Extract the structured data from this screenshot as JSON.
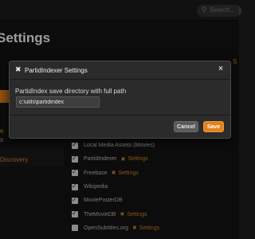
{
  "app": {
    "page_title": "Settings",
    "search_placeholder": "Search..."
  },
  "background_left": {
    "frag1": "e",
    "frag2": "s",
    "discovery": "Discovery"
  },
  "background_right": {
    "frag": "S"
  },
  "plugins": [
    {
      "name": "Local Media Assets (Movies)",
      "checked": true,
      "settings": ""
    },
    {
      "name": "PartidIndexer",
      "checked": true,
      "settings": "Settings"
    },
    {
      "name": "Freebase",
      "checked": true,
      "settings": "Settings"
    },
    {
      "name": "Wikipedia",
      "checked": true,
      "settings": ""
    },
    {
      "name": "MoviePosterDB",
      "checked": true,
      "settings": ""
    },
    {
      "name": "TheMovieDB",
      "checked": true,
      "settings": "Settings"
    },
    {
      "name": "OpenSubtitles.org",
      "checked": false,
      "settings": "Settings"
    }
  ],
  "dialog": {
    "title": "PartidIndexer Settings",
    "label": "PartidIndex save directory with full path",
    "input_value": "c:\\utils\\partidindex",
    "cancel_label": "Cancel",
    "save_label": "Save",
    "close_glyph": "×",
    "icon": "wrench-icon"
  },
  "colors": {
    "accent": "#e3821c",
    "background": "#131313",
    "dialog_bg": "#2b2b2b"
  }
}
